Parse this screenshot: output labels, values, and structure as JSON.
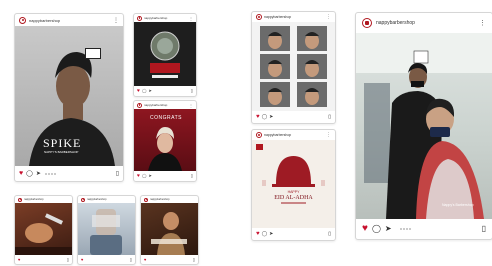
{
  "account": {
    "handle": "nappybarbershop"
  },
  "icons": {
    "like": "heart-icon",
    "comment": "comment-icon",
    "share": "send-icon",
    "save": "bookmark-icon",
    "more": "more-icon"
  },
  "colors": {
    "brand": "#b0171f",
    "like": "#c8102e"
  },
  "posts": {
    "spike": {
      "title": "SPIKE",
      "brand": "NAPPY'S BARBERSHOP"
    },
    "event": {
      "brand": "NAPPY'S",
      "headline": "CONGRATS"
    },
    "eid": {
      "greeting": "EID AL-ADHA",
      "line": "HAPPY"
    },
    "barber": {
      "caption": "Nappy's Barbershop"
    }
  }
}
